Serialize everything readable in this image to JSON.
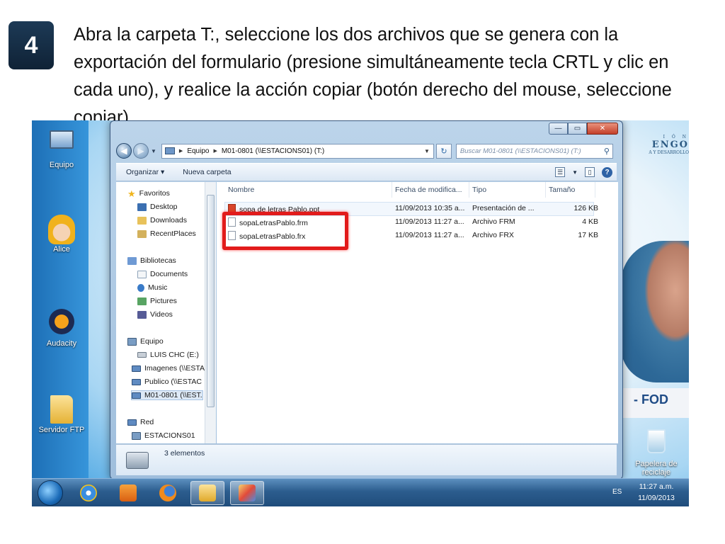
{
  "slide": {
    "step_number": "4",
    "instruction": "Abra la carpeta T:, seleccione los dos archivos que se genera con la exportación del formulario  (presione simultáneamente tecla CRTL y clic en cada uno), y realice la acción copiar (botón derecho del mouse, seleccione copiar)."
  },
  "desktop": {
    "icons": [
      {
        "label": "Equipo",
        "icon": "computer-icon"
      },
      {
        "label": "Alice",
        "icon": "alice-icon"
      },
      {
        "label": "Audacity",
        "icon": "audacity-icon"
      },
      {
        "label": "Servidor FTP",
        "icon": "folder-icon"
      },
      {
        "label": "Papelera de reciclaje",
        "icon": "recycle-bin-icon"
      }
    ],
    "wallpaper_text": {
      "line1": "I Ó N",
      "line2": "ENGO",
      "line3": "A Y DESARROLLO",
      "brand": "- FOD"
    }
  },
  "window": {
    "controls": {
      "minimize": "—",
      "maximize": "▭",
      "close": "✕"
    },
    "address": {
      "crumbs": [
        "Equipo",
        "M01-0801 (\\\\ESTACIONS01) (T:)"
      ]
    },
    "search_placeholder": "Buscar M01-0801 (\\\\ESTACIONS01) (T:)",
    "toolbar": {
      "organize": "Organizar ▾",
      "new_folder": "Nueva carpeta"
    },
    "nav": {
      "favorites": "Favoritos",
      "favorite_items": [
        "Desktop",
        "Downloads",
        "RecentPlaces"
      ],
      "libraries": "Bibliotecas",
      "library_items": [
        "Documents",
        "Music",
        "Pictures",
        "Videos"
      ],
      "computer": "Equipo",
      "computer_items": [
        "LUIS CHC (E:)",
        "Imagenes (\\\\ESTA",
        "Publico (\\\\ESTAC",
        "M01-0801 (\\\\EST."
      ],
      "network": "Red",
      "network_items": [
        "ESTACIONS01"
      ]
    },
    "columns": [
      "Nombre",
      "Fecha de modifica...",
      "Tipo",
      "Tamaño"
    ],
    "files": [
      {
        "name": "sopa de letras Pablo.ppt",
        "date": "11/09/2013 10:35 a...",
        "type": "Presentación de ...",
        "size": "126 KB"
      },
      {
        "name": "sopaLetrasPablo.frm",
        "date": "11/09/2013 11:27 a...",
        "type": "Archivo FRM",
        "size": "4 KB"
      },
      {
        "name": "sopaLetrasPablo.frx",
        "date": "11/09/2013 11:27 a...",
        "type": "Archivo FRX",
        "size": "17 KB"
      }
    ],
    "status_text": "3 elementos"
  },
  "taskbar": {
    "language": "ES",
    "time": "11:27 a.m.",
    "date": "11/09/2013"
  },
  "colors": {
    "highlight": "#e21b1b",
    "badge": "#1d3a56"
  }
}
